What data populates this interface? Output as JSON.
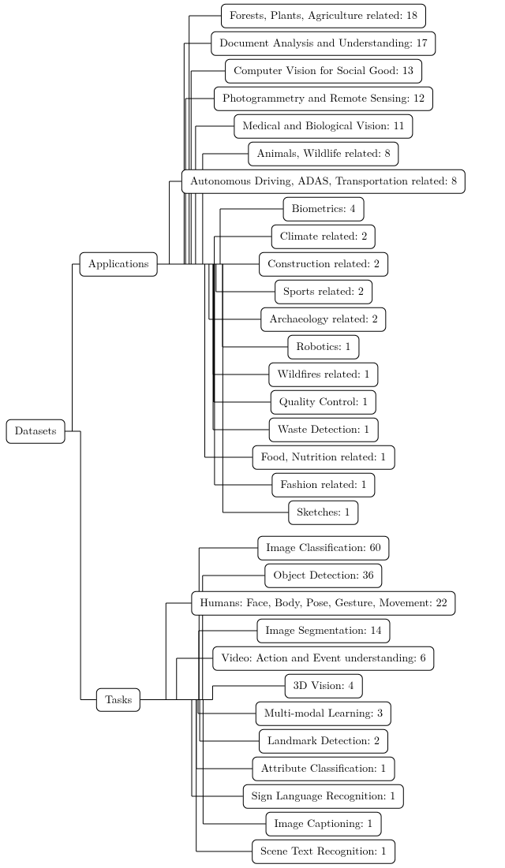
{
  "root": "Datasets",
  "branches": {
    "applications": {
      "label": "Applications",
      "items": [
        "Forests, Plants, Agriculture related: 18",
        "Document Analysis and Understanding: 17",
        "Computer Vision for Social Good: 13",
        "Photogrammetry and Remote Sensing: 12",
        "Medical and Biological Vision: 11",
        "Animals, Wildlife related: 8",
        "Autonomous Driving, ADAS, Transportation related: 8",
        "Biometrics: 4",
        "Climate related: 2",
        "Construction related: 2",
        "Sports related: 2",
        "Archaeology related: 2",
        "Robotics: 1",
        "Wildfires related: 1",
        "Quality Control: 1",
        "Waste Detection: 1",
        "Food, Nutrition related: 1",
        "Fashion related: 1",
        "Sketches: 1"
      ]
    },
    "tasks": {
      "label": "Tasks",
      "items": [
        "Image Classification: 60",
        "Object Detection: 36",
        "Humans: Face, Body, Pose, Gesture, Movement: 22",
        "Image Segmentation: 14",
        "Video: Action and Event understanding: 6",
        "3D Vision: 4",
        "Multi-modal Learning: 3",
        "Landmark Detection: 2",
        "Attribute Classification: 1",
        "Sign Language Recognition: 1",
        "Image Captioning: 1",
        "Scene Text Recognition: 1"
      ]
    }
  },
  "chart_data": {
    "type": "tree",
    "root": "Datasets",
    "children": [
      {
        "name": "Applications",
        "children": [
          {
            "name": "Forests, Plants, Agriculture related",
            "value": 18
          },
          {
            "name": "Document Analysis and Understanding",
            "value": 17
          },
          {
            "name": "Computer Vision for Social Good",
            "value": 13
          },
          {
            "name": "Photogrammetry and Remote Sensing",
            "value": 12
          },
          {
            "name": "Medical and Biological Vision",
            "value": 11
          },
          {
            "name": "Animals, Wildlife related",
            "value": 8
          },
          {
            "name": "Autonomous Driving, ADAS, Transportation related",
            "value": 8
          },
          {
            "name": "Biometrics",
            "value": 4
          },
          {
            "name": "Climate related",
            "value": 2
          },
          {
            "name": "Construction related",
            "value": 2
          },
          {
            "name": "Sports related",
            "value": 2
          },
          {
            "name": "Archaeology related",
            "value": 2
          },
          {
            "name": "Robotics",
            "value": 1
          },
          {
            "name": "Wildfires related",
            "value": 1
          },
          {
            "name": "Quality Control",
            "value": 1
          },
          {
            "name": "Waste Detection",
            "value": 1
          },
          {
            "name": "Food, Nutrition related",
            "value": 1
          },
          {
            "name": "Fashion related",
            "value": 1
          },
          {
            "name": "Sketches",
            "value": 1
          }
        ]
      },
      {
        "name": "Tasks",
        "children": [
          {
            "name": "Image Classification",
            "value": 60
          },
          {
            "name": "Object Detection",
            "value": 36
          },
          {
            "name": "Humans: Face, Body, Pose, Gesture, Movement",
            "value": 22
          },
          {
            "name": "Image Segmentation",
            "value": 14
          },
          {
            "name": "Video: Action and Event understanding",
            "value": 6
          },
          {
            "name": "3D Vision",
            "value": 4
          },
          {
            "name": "Multi-modal Learning",
            "value": 3
          },
          {
            "name": "Landmark Detection",
            "value": 2
          },
          {
            "name": "Attribute Classification",
            "value": 1
          },
          {
            "name": "Sign Language Recognition",
            "value": 1
          },
          {
            "name": "Image Captioning",
            "value": 1
          },
          {
            "name": "Scene Text Recognition",
            "value": 1
          }
        ]
      }
    ]
  }
}
